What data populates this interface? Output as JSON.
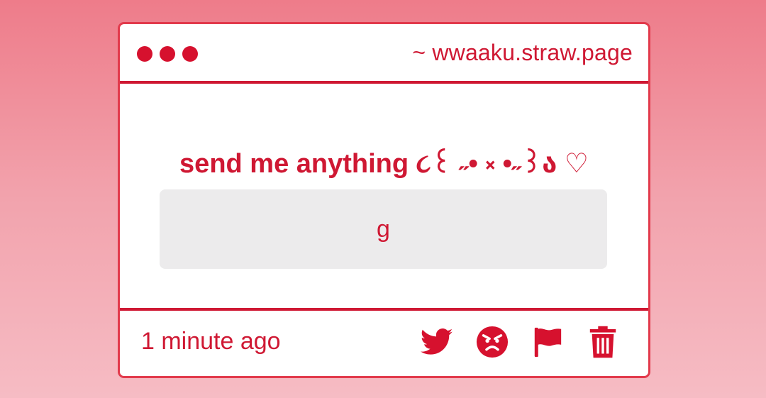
{
  "window": {
    "url": "~ wwaaku.straw.page"
  },
  "content": {
    "prompt": "send me anything ૮꒰ ˶• ༝ •˶꒱ა ♡",
    "message": "g"
  },
  "footer": {
    "timestamp": "1 minute ago",
    "actions": [
      "twitter-icon",
      "angry-face-icon",
      "flag-icon",
      "trash-icon"
    ]
  },
  "colors": {
    "accent": "#cf1833",
    "border": "#e23a4c",
    "message_bg": "#ecebec",
    "background_top": "#ee7c8a",
    "background_bottom": "#f6bcc4"
  }
}
